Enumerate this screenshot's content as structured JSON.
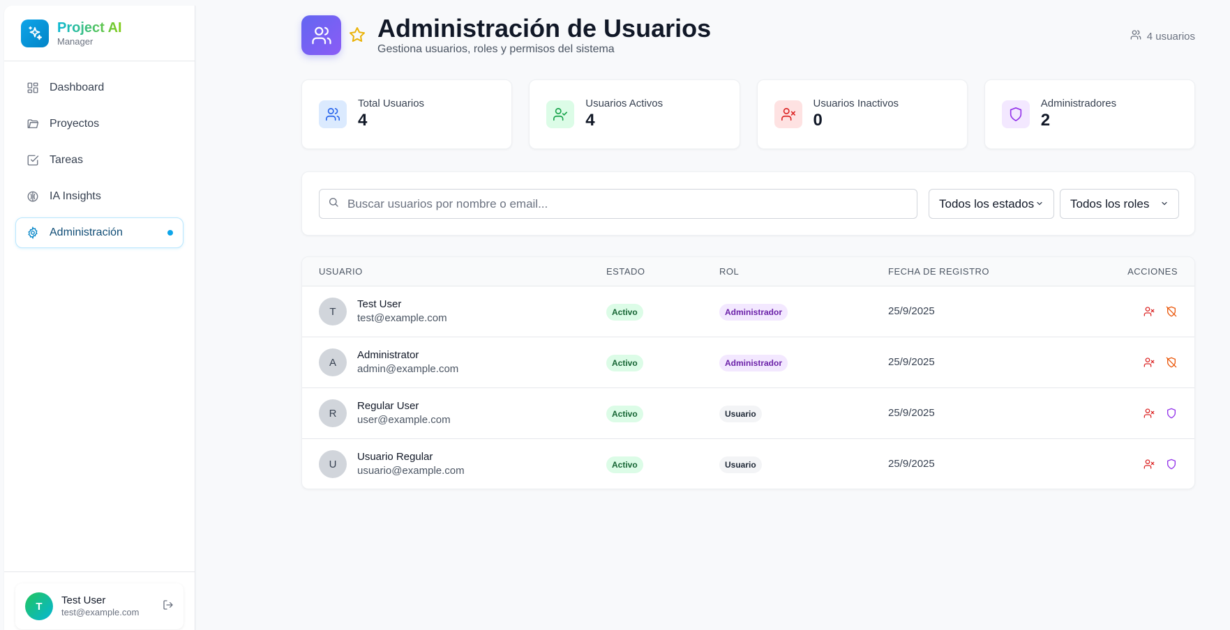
{
  "sidebar": {
    "brand_name": "Project AI",
    "brand_sub": "Manager",
    "items": [
      {
        "label": "Dashboard",
        "icon": "grid-icon"
      },
      {
        "label": "Proyectos",
        "icon": "folder-icon"
      },
      {
        "label": "Tareas",
        "icon": "checkbox-icon"
      },
      {
        "label": "IA Insights",
        "icon": "brain-icon"
      },
      {
        "label": "Administración",
        "icon": "gear-icon",
        "active": true
      }
    ],
    "user": {
      "initial": "T",
      "name": "Test User",
      "email": "test@example.com"
    }
  },
  "header": {
    "title": "Administración de Usuarios",
    "subtitle": "Gestiona usuarios, roles y permisos del sistema",
    "user_count": "4 usuarios"
  },
  "stats": [
    {
      "label": "Total Usuarios",
      "value": "4",
      "color": "#2563eb",
      "bg": "#dbeafe"
    },
    {
      "label": "Usuarios Activos",
      "value": "4",
      "color": "#16a34a",
      "bg": "#dcfce7"
    },
    {
      "label": "Usuarios Inactivos",
      "value": "0",
      "color": "#dc2626",
      "bg": "#fee2e2"
    },
    {
      "label": "Administradores",
      "value": "2",
      "color": "#9333ea",
      "bg": "#f3e8ff"
    }
  ],
  "filters": {
    "search_placeholder": "Buscar usuarios por nombre o email...",
    "status_select": "Todos los estados",
    "role_select": "Todos los roles"
  },
  "table": {
    "headers": [
      "USUARIO",
      "ESTADO",
      "ROL",
      "FECHA DE REGISTRO",
      "ACCIONES"
    ],
    "rows": [
      {
        "initial": "T",
        "name": "Test User",
        "email": "test@example.com",
        "status": "Activo",
        "role": "Administrador",
        "date": "25/9/2025"
      },
      {
        "initial": "A",
        "name": "Administrator",
        "email": "admin@example.com",
        "status": "Activo",
        "role": "Administrador",
        "date": "25/9/2025"
      },
      {
        "initial": "R",
        "name": "Regular User",
        "email": "user@example.com",
        "status": "Activo",
        "role": "Usuario",
        "date": "25/9/2025"
      },
      {
        "initial": "U",
        "name": "Usuario Regular",
        "email": "usuario@example.com",
        "status": "Activo",
        "role": "Usuario",
        "date": "25/9/2025"
      }
    ]
  }
}
